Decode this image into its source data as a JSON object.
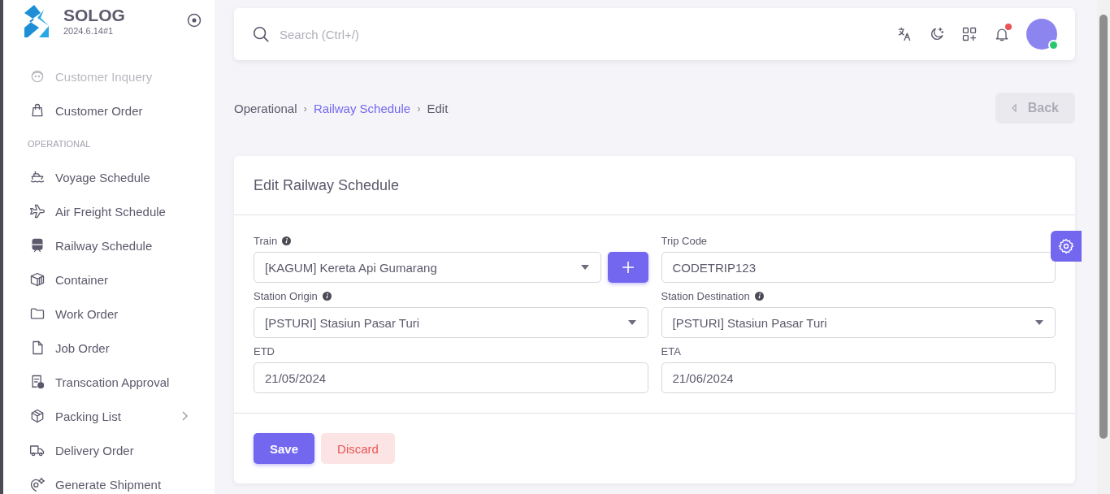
{
  "brand": {
    "name": "SOLOG",
    "version": "2024.6.14#1"
  },
  "sidebar": {
    "items": [
      {
        "label": "Customer Inquery",
        "kind": "link",
        "disabled": true
      },
      {
        "label": "Customer Order",
        "kind": "link",
        "disabled": false
      },
      {
        "label": "OPERATIONAL",
        "kind": "section"
      },
      {
        "label": "Voyage Schedule",
        "kind": "link",
        "disabled": false
      },
      {
        "label": "Air Freight Schedule",
        "kind": "link",
        "disabled": false
      },
      {
        "label": "Railway Schedule",
        "kind": "link",
        "disabled": false
      },
      {
        "label": "Container",
        "kind": "link",
        "disabled": false
      },
      {
        "label": "Work Order",
        "kind": "link",
        "disabled": false
      },
      {
        "label": "Job Order",
        "kind": "link",
        "disabled": false
      },
      {
        "label": "Transcation Approval",
        "kind": "link",
        "disabled": false
      },
      {
        "label": "Packing List",
        "kind": "submenu",
        "disabled": false
      },
      {
        "label": "Delivery Order",
        "kind": "link",
        "disabled": false
      },
      {
        "label": "Generate Shipment",
        "kind": "link",
        "disabled": false
      }
    ]
  },
  "topbar": {
    "search": {
      "placeholder": "Search (Ctrl+/)"
    },
    "notification_unread": true,
    "user_online": true
  },
  "breadcrumb": {
    "separator": "›",
    "items": [
      {
        "label": "Operational",
        "link": false
      },
      {
        "label": "Railway Schedule",
        "link": true
      },
      {
        "label": "Edit",
        "link": false
      }
    ]
  },
  "back_button": {
    "label": "Back",
    "disabled": true
  },
  "form": {
    "title": "Edit Railway Schedule",
    "fields": [
      {
        "label": "Train",
        "kind": "select",
        "value": "[KAGUM] Kereta Api Gumarang",
        "info": true,
        "add_button": true
      },
      {
        "label": "Trip Code",
        "kind": "text",
        "value": "CODETRIP123",
        "info": false,
        "add_button": false
      },
      {
        "label": "Station Origin",
        "kind": "select",
        "value": "[PSTURI] Stasiun Pasar Turi",
        "info": true,
        "add_button": false
      },
      {
        "label": "Station Destination",
        "kind": "select",
        "value": "[PSTURI] Stasiun Pasar Turi",
        "info": true,
        "add_button": false
      },
      {
        "label": "ETD",
        "kind": "text",
        "value": "21/05/2024",
        "info": false,
        "add_button": false
      },
      {
        "label": "ETA",
        "kind": "text",
        "value": "21/06/2024",
        "info": false,
        "add_button": false
      }
    ],
    "buttons": [
      {
        "label": "Save",
        "kind": "primary"
      },
      {
        "label": "Discard",
        "kind": "danger"
      }
    ]
  }
}
